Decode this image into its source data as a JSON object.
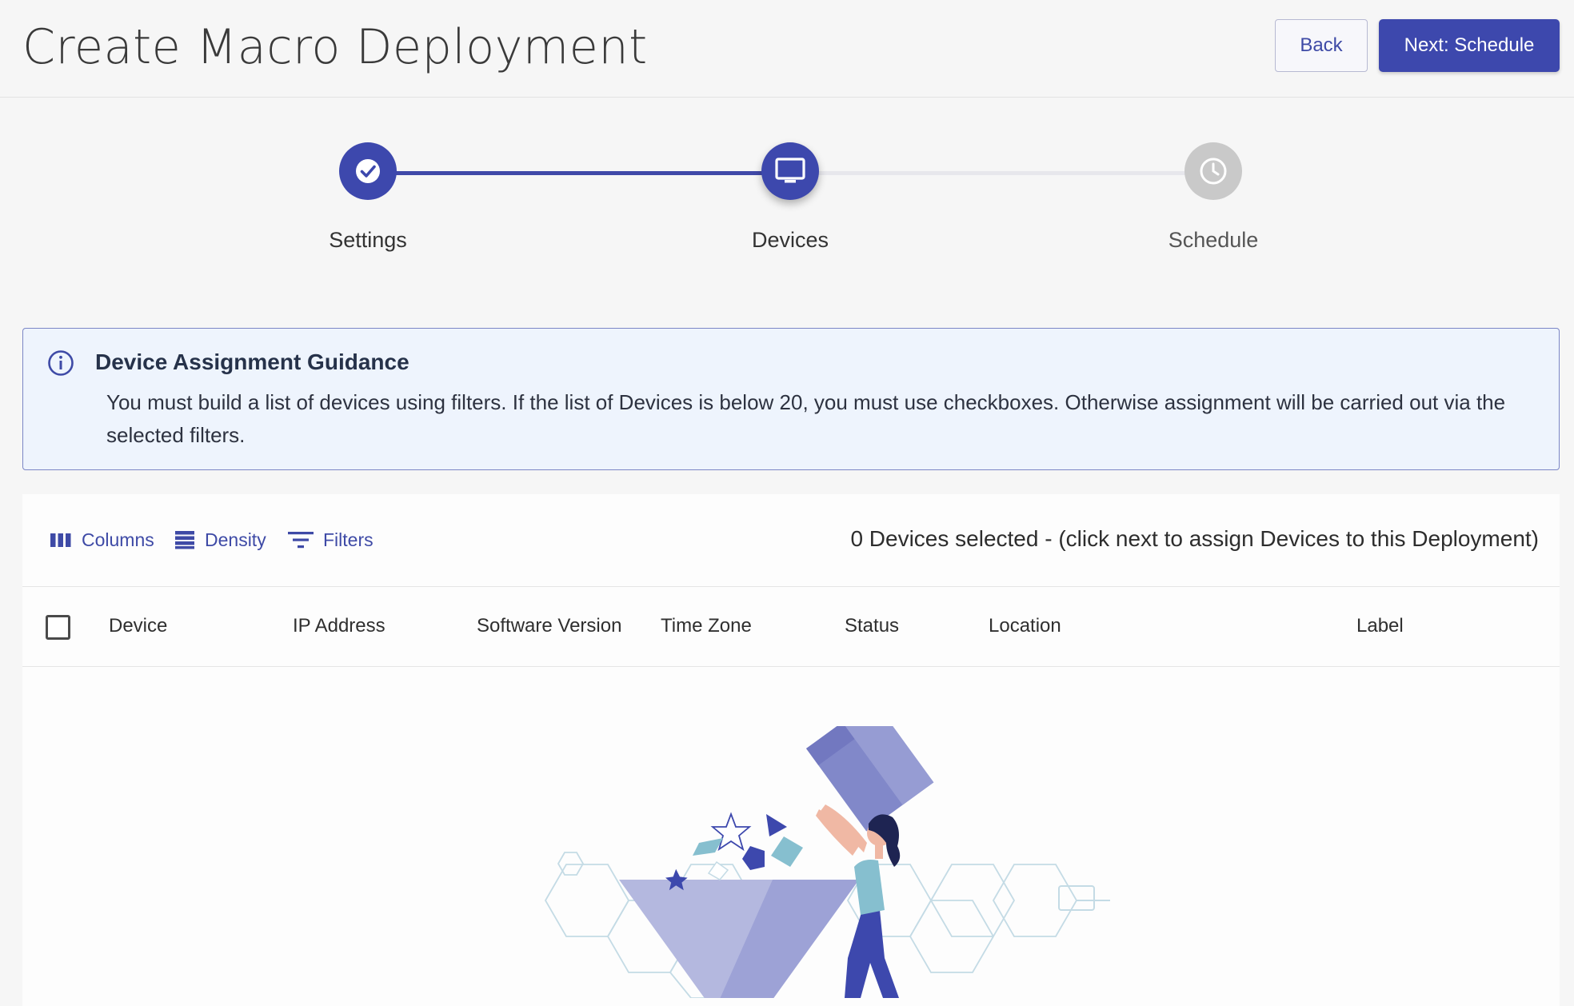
{
  "header": {
    "title": "Create Macro Deployment",
    "back_label": "Back",
    "next_label": "Next: Schedule",
    "accent_color": "#3d48ad"
  },
  "stepper": {
    "steps": [
      {
        "label": "Settings",
        "state": "completed",
        "icon": "check-icon"
      },
      {
        "label": "Devices",
        "state": "active",
        "icon": "monitor-icon"
      },
      {
        "label": "Schedule",
        "state": "pending",
        "icon": "clock-icon"
      }
    ]
  },
  "guidance": {
    "title": "Device Assignment Guidance",
    "text": "You must build a list of devices using filters. If the list of Devices is below 20, you must use checkboxes. Otherwise assignment will be carried out via the selected filters.",
    "icon": "info-icon"
  },
  "toolbar": {
    "columns_label": "Columns",
    "density_label": "Density",
    "filters_label": "Filters",
    "selection_status": "0 Devices selected - (click next to assign Devices to this Deployment)"
  },
  "table": {
    "columns": [
      "Device",
      "IP Address",
      "Software Version",
      "Time Zone",
      "Status",
      "Location",
      "Label"
    ],
    "rows": []
  }
}
